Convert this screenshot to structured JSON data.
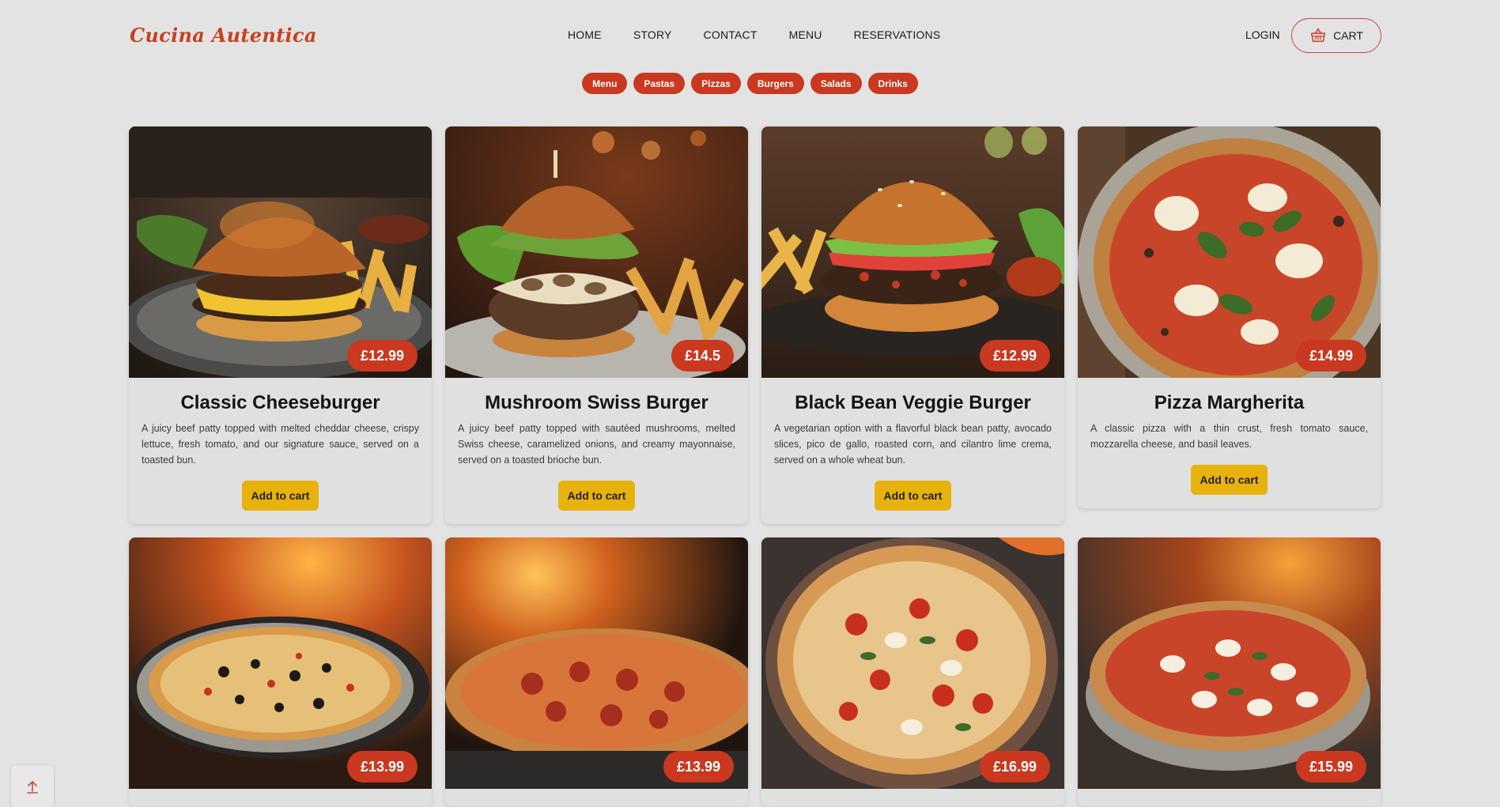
{
  "header": {
    "logo": "Cucina Autentica",
    "nav": [
      "HOME",
      "STORY",
      "CONTACT",
      "MENU",
      "RESERVATIONS"
    ],
    "login": "LOGIN",
    "cart": "CART"
  },
  "categories": [
    "Menu",
    "Pastas",
    "Pizzas",
    "Burgers",
    "Salads",
    "Drinks"
  ],
  "colors": {
    "accent": "#c9381f",
    "button": "#e7b20c",
    "background": "#e3e3e3"
  },
  "products": [
    {
      "name": "Classic Cheeseburger",
      "price": "£12.99",
      "description": "A juicy beef patty topped with melted cheddar cheese, crispy lettuce, fresh tomato, and our signature sauce, served on a toasted bun.",
      "button": "Add to cart"
    },
    {
      "name": "Mushroom Swiss Burger",
      "price": "£14.5",
      "description": "A juicy beef patty topped with sautéed mushrooms, melted Swiss cheese, caramelized onions, and creamy mayonnaise, served on a toasted brioche bun.",
      "button": "Add to cart"
    },
    {
      "name": "Black Bean Veggie Burger",
      "price": "£12.99",
      "description": "A vegetarian option with a flavorful black bean patty, avocado slices, pico de gallo, roasted corn, and cilantro lime crema, served on a whole wheat bun.",
      "button": "Add to cart"
    },
    {
      "name": "Pizza Margherita",
      "price": "£14.99",
      "description": "A classic pizza with a thin crust, fresh tomato sauce, mozzarella cheese, and basil leaves.",
      "button": "Add to cart"
    },
    {
      "name": "",
      "price": "£13.99",
      "description": "",
      "button": ""
    },
    {
      "name": "",
      "price": "£13.99",
      "description": "",
      "button": ""
    },
    {
      "name": "",
      "price": "£16.99",
      "description": "",
      "button": ""
    },
    {
      "name": "",
      "price": "£15.99",
      "description": "",
      "button": ""
    }
  ],
  "icons": {
    "cart": "basket-icon",
    "scroll_top": "arrow-up-icon"
  }
}
